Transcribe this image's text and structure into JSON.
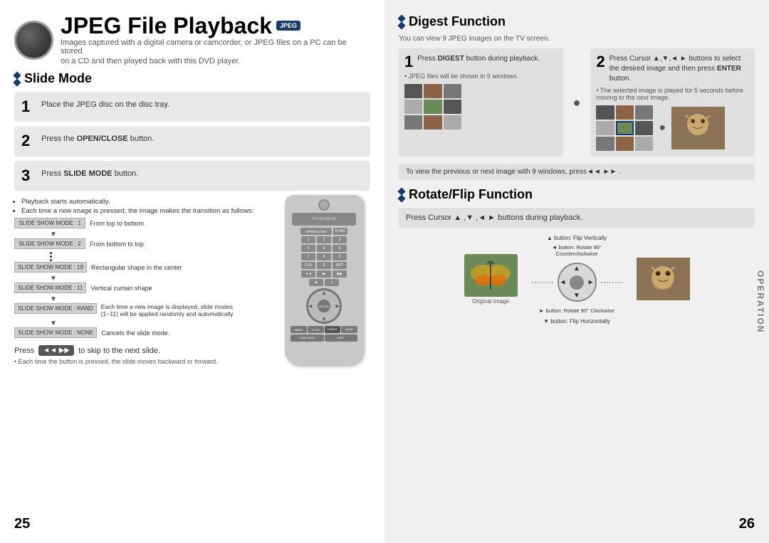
{
  "page": {
    "left_number": "25",
    "right_number": "26"
  },
  "header": {
    "title": "JPEG File Playback",
    "badge": "JPEG",
    "subtitle_line1": "Images captured with a digital camera or camcorder, or JPEG files on a PC can be stored",
    "subtitle_line2": "on a CD and then played back with this DVD player."
  },
  "slide_mode": {
    "title": "Slide Mode",
    "steps": [
      {
        "number": "1",
        "text": "Place the JPEG disc on the disc tray."
      },
      {
        "number": "2",
        "text_before": "Press the ",
        "bold": "OPEN/CLOSE",
        "text_after": " button."
      },
      {
        "number": "3",
        "text_before": "Press ",
        "bold": "SLIDE MODE",
        "text_after": " button."
      }
    ],
    "bullets": [
      "Playback starts automatically.",
      "Each time a new image is pressed, the image makes the transition as follows:"
    ],
    "modes": [
      {
        "label": "SLIDE SHOW MODE : 1",
        "desc": "From top to bottom"
      },
      {
        "label": "SLIDE SHOW MODE : 2",
        "desc": "From bottom to top"
      },
      {
        "label": "SLIDE SHOW MODE : 10",
        "desc": "Rectangular shape in the center"
      },
      {
        "label": "SLIDE SHOW MODE : 11",
        "desc": "Vertical curtain shape"
      },
      {
        "label": "SLIDE SHOW MODE : RAND",
        "desc": "Each time a new image is displayed, slide modes (1~11) will be applied randomly and automatically"
      },
      {
        "label": "SLIDE SHOW MODE : NONE",
        "desc": "Cancels the slide mode."
      }
    ],
    "press_skip_label": "Press",
    "press_skip_text": "to skip to the next slide.",
    "bottom_note": "• Each time the button is pressed, the slide moves backward or forward."
  },
  "digest_function": {
    "title": "Digest Function",
    "subtitle": "You can view 9 JPEG images on the TV screen.",
    "step1": {
      "number": "1",
      "text_bold": "DIGEST",
      "text_before": "Press ",
      "text_after": " button during playback.",
      "note": "• JPEG files will be shown in 9 windows."
    },
    "step2": {
      "number": "2",
      "text_before": "Press Cursor ",
      "arrows": "▲,▼,◄ ►",
      "text_after": " buttons to select the desired image and then press ",
      "bold2": "ENTER",
      "text_end": " button.",
      "note": "• The selected image is played for 5 seconds before moving to the next image."
    },
    "nav_hint": "To view the previous or next image with 9 windows, press◄◄ ►►  ."
  },
  "rotate_flip": {
    "title": "Rotate/Flip Function",
    "instruction": "Press Cursor ▲ ,▼ ,◄  ►   buttons during playback.",
    "labels": {
      "original": "Original Image",
      "flip_vertical": "▲ button: Flip Vertically",
      "rotate_ccw": "◄ button: Rotate 90° Counterclockwise",
      "rotate_cw": "► button: Rotate 90° Clockwise",
      "flip_horizontal": "▼ button: Flip Horizontally"
    }
  },
  "operation_label": "OPERATION"
}
